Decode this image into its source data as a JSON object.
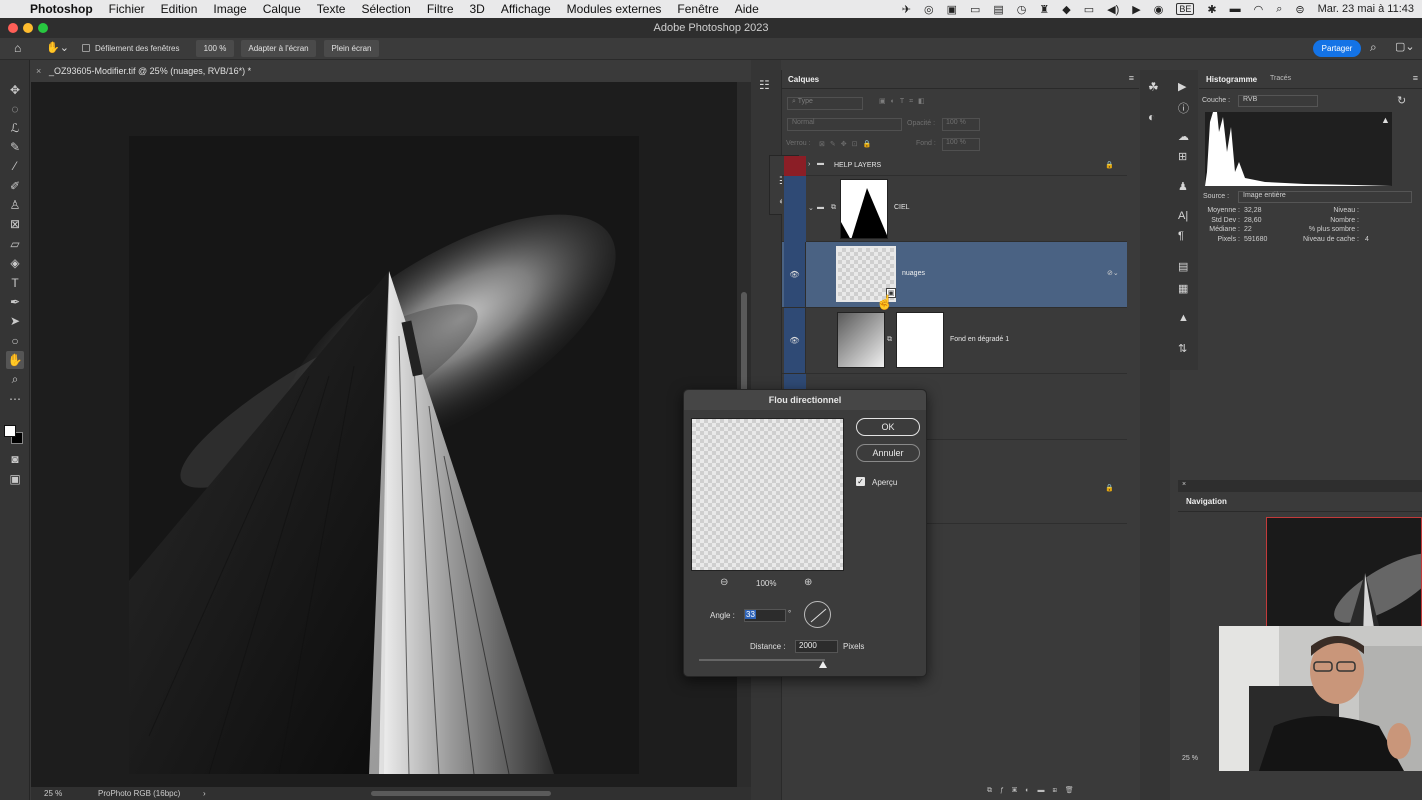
{
  "menubar": {
    "items": [
      "Photoshop",
      "Fichier",
      "Edition",
      "Image",
      "Calque",
      "Texte",
      "Sélection",
      "Filtre",
      "3D",
      "Affichage",
      "Modules externes",
      "Fenêtre",
      "Aide"
    ],
    "tray_badge": "BE",
    "clock": "Mar. 23 mai à 11:43"
  },
  "window": {
    "title": "Adobe Photoshop 2023"
  },
  "options_bar": {
    "scroll_all_windows": "Défilement des fenêtres",
    "zoom_button": "100 %",
    "fit_screen_button": "Adapter à l'écran",
    "full_screen_button": "Plein écran",
    "share_button": "Partager"
  },
  "document": {
    "tab_title": "_OZ93605-Modifier.tif @ 25% (nuages, RVB/16*) *",
    "zoom": "25 %",
    "color_profile": "ProPhoto RGB (16bpc)"
  },
  "layers_panel": {
    "tab": "Calques",
    "filter_kind": "Type",
    "blend_mode": "Normal",
    "opacity_label": "Opacité :",
    "opacity_value": "100 %",
    "lock_label": "Verrou :",
    "fill_label": "Fond :",
    "fill_value": "100 %",
    "layers": [
      {
        "name": "HELP LAYERS",
        "kind": "group"
      },
      {
        "name": "CIEL",
        "kind": "group-mask"
      },
      {
        "name": "nuages",
        "kind": "smart",
        "selected": true
      },
      {
        "name": "Fond en dégradé 1",
        "kind": "gradient-fill"
      }
    ]
  },
  "histogram_panel": {
    "tab_active": "Histogramme",
    "tab_other": "Tracés",
    "channel_label": "Couche :",
    "channel_value": "RVB",
    "source_label": "Source :",
    "source_value": "Image entière",
    "stats_left": [
      {
        "label": "Moyenne :",
        "value": "32,28"
      },
      {
        "label": "Std Dev :",
        "value": "28,60"
      },
      {
        "label": "Médiane :",
        "value": "22"
      },
      {
        "label": "Pixels :",
        "value": "591680"
      }
    ],
    "stats_right": [
      {
        "label": "Niveau :",
        "value": ""
      },
      {
        "label": "Nombre :",
        "value": ""
      },
      {
        "label": "% plus sombre :",
        "value": ""
      },
      {
        "label": "Niveau de cache :",
        "value": "4"
      }
    ]
  },
  "navigator_panel": {
    "tab": "Navigation",
    "zoom": "25 %"
  },
  "dialog": {
    "title": "Flou directionnel",
    "ok": "OK",
    "cancel": "Annuler",
    "preview_label": "Aperçu",
    "preview_checked": true,
    "preview_zoom": "100%",
    "angle_label": "Angle :",
    "angle_value": "33",
    "angle_unit": "°",
    "distance_label": "Distance :",
    "distance_value": "2000",
    "distance_unit": "Pixels"
  },
  "colors": {
    "accent": "#1473e6",
    "selected_layer": "#4a6283",
    "panel_bg": "#3a3a3a"
  }
}
